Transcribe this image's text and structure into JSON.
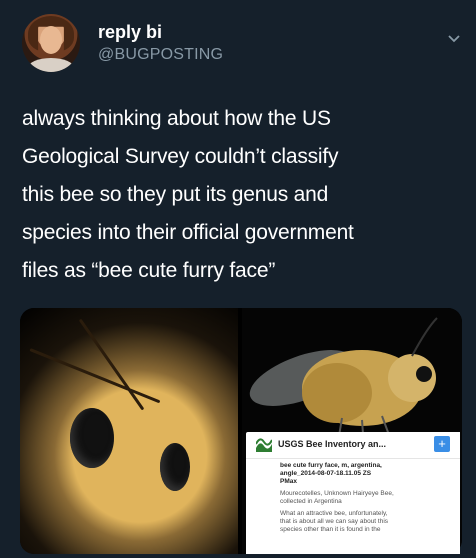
{
  "tweet": {
    "display_name": "reply bi",
    "handle": "@BUGPOSTING",
    "text": "always thinking about how the US Geological Survey couldn’t classify this bee so they put its genus and species into their official government files as “bee cute furry face”",
    "text_lines": [
      "always thinking about how the US",
      "Geological Survey couldn’t classify",
      "this bee so they put its genus and",
      "species into their official government",
      "files as “bee cute furry face”"
    ]
  },
  "icons": {
    "chevron": "chevron-down-icon",
    "usgs": "usgs-logo-icon",
    "plus": "plus-icon"
  },
  "card": {
    "title": "USGS Bee Inventory an...",
    "plus_label": "+",
    "line1": "bee cute furry face, m, argentina,",
    "line2": "angle_2014-08-07-18.11.05 ZS",
    "line3": "PMax",
    "line4": "Mourecotelles, Unknown Hairyeye Bee,",
    "line5": "collected in Argentina",
    "line6": "What an attractive bee, unfortunately,",
    "line7": "that is about all we can say about this",
    "line8": "species other than it is found in the"
  },
  "colors": {
    "background": "#15202b",
    "secondary_text": "#8899a6",
    "accent": "#3a8ee6"
  }
}
